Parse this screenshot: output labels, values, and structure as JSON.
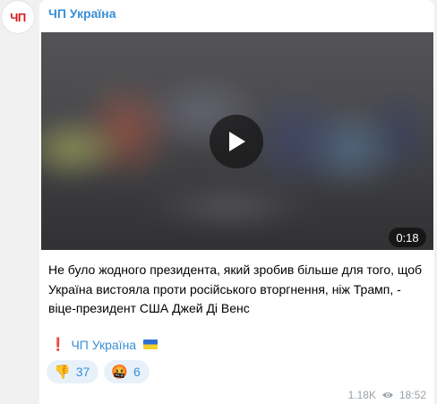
{
  "channel": {
    "avatar_text": "ЧП",
    "name": "ЧП Україна"
  },
  "video": {
    "duration": "0:18",
    "play_icon": "play-icon"
  },
  "message": {
    "text": "Не було жодного президента, який зробив більше для того, щоб Україна вистояла проти російського вторгнення, ніж Трамп, - віце-президент США Джей Ді Венс",
    "signature_prefix": "❗",
    "signature": "ЧП Україна",
    "signature_flag": "ukraine-flag-icon"
  },
  "reactions": [
    {
      "emoji": "👎",
      "count": "37"
    },
    {
      "emoji": "🤬",
      "count": "6"
    }
  ],
  "meta": {
    "views": "1.18K",
    "time": "18:52"
  },
  "colors": {
    "accent": "#3a8fd6",
    "avatar_text": "#d71920",
    "reaction_bg": "#e8f1fa",
    "page_bg": "#f1f1f1"
  }
}
